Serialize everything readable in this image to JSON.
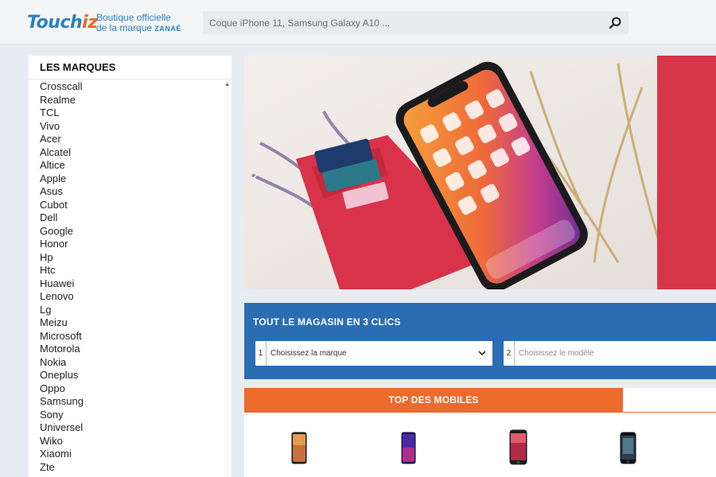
{
  "header": {
    "logo_main": "Touch",
    "logo_accent": "iz",
    "logo_sub_line1": "Boutique officielle",
    "logo_sub_line2": "de la marque",
    "logo_brand": "ZANAÉ",
    "search_placeholder": "Coque iPhone 11, Samsung Galaxy A10 ..."
  },
  "sidebar": {
    "title": "LES MARQUES",
    "brands": [
      "Crosscall",
      "Realme",
      "TCL",
      "Vivo",
      "Acer",
      "Alcatel",
      "Altice",
      "Apple",
      "Asus",
      "Cubot",
      "Dell",
      "Google",
      "Honor",
      "Hp",
      "Htc",
      "Huawei",
      "Lenovo",
      "Lg",
      "Meizu",
      "Microsoft",
      "Motorola",
      "Nokia",
      "Oneplus",
      "Oppo",
      "Samsung",
      "Sony",
      "Universel",
      "Wiko",
      "Xiaomi",
      "Zte"
    ]
  },
  "finder": {
    "title": "TOUT LE MAGASIN EN 3 CLICS",
    "step1_num": "1",
    "step1_label": "Choisissez la marque",
    "step2_num": "2",
    "step2_label": "Choisissez le modèle"
  },
  "top_mobiles": {
    "title": "TOP DES MOBILES"
  },
  "colors": {
    "brand_blue": "#2d7fc1",
    "brand_orange": "#f0652a",
    "finder_bg": "#2b6db3",
    "top_tab": "#ec6a2c",
    "banner_red": "#d7354a"
  }
}
